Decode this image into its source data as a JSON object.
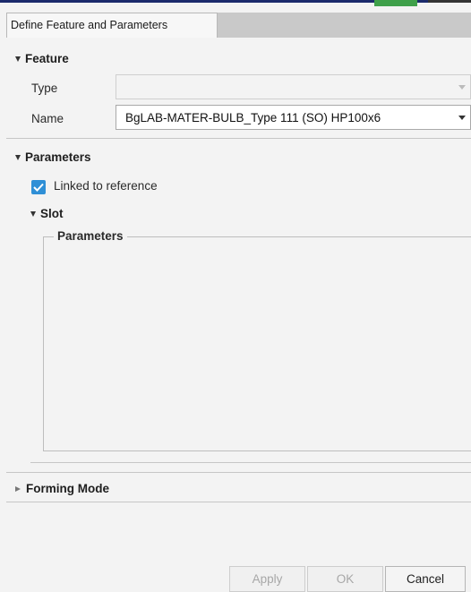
{
  "tab": {
    "title": "Define Feature and Parameters"
  },
  "feature": {
    "header": "Feature",
    "type_label": "Type",
    "type_value": "",
    "name_label": "Name",
    "name_value": "BgLAB-MATER-BULB_Type 111 (SO) HP100x6"
  },
  "parameters": {
    "header": "Parameters",
    "linked_label": "Linked to reference",
    "linked_checked": true,
    "slot_header": "Slot",
    "group_title": "Parameters"
  },
  "forming": {
    "header": "Forming Mode"
  },
  "buttons": {
    "apply": "Apply",
    "ok": "OK",
    "cancel": "Cancel"
  },
  "colors": {
    "accent": "#2f8fd6",
    "panel_bg": "#f3f3f3",
    "tabbar_bg": "#c9c9c9"
  }
}
